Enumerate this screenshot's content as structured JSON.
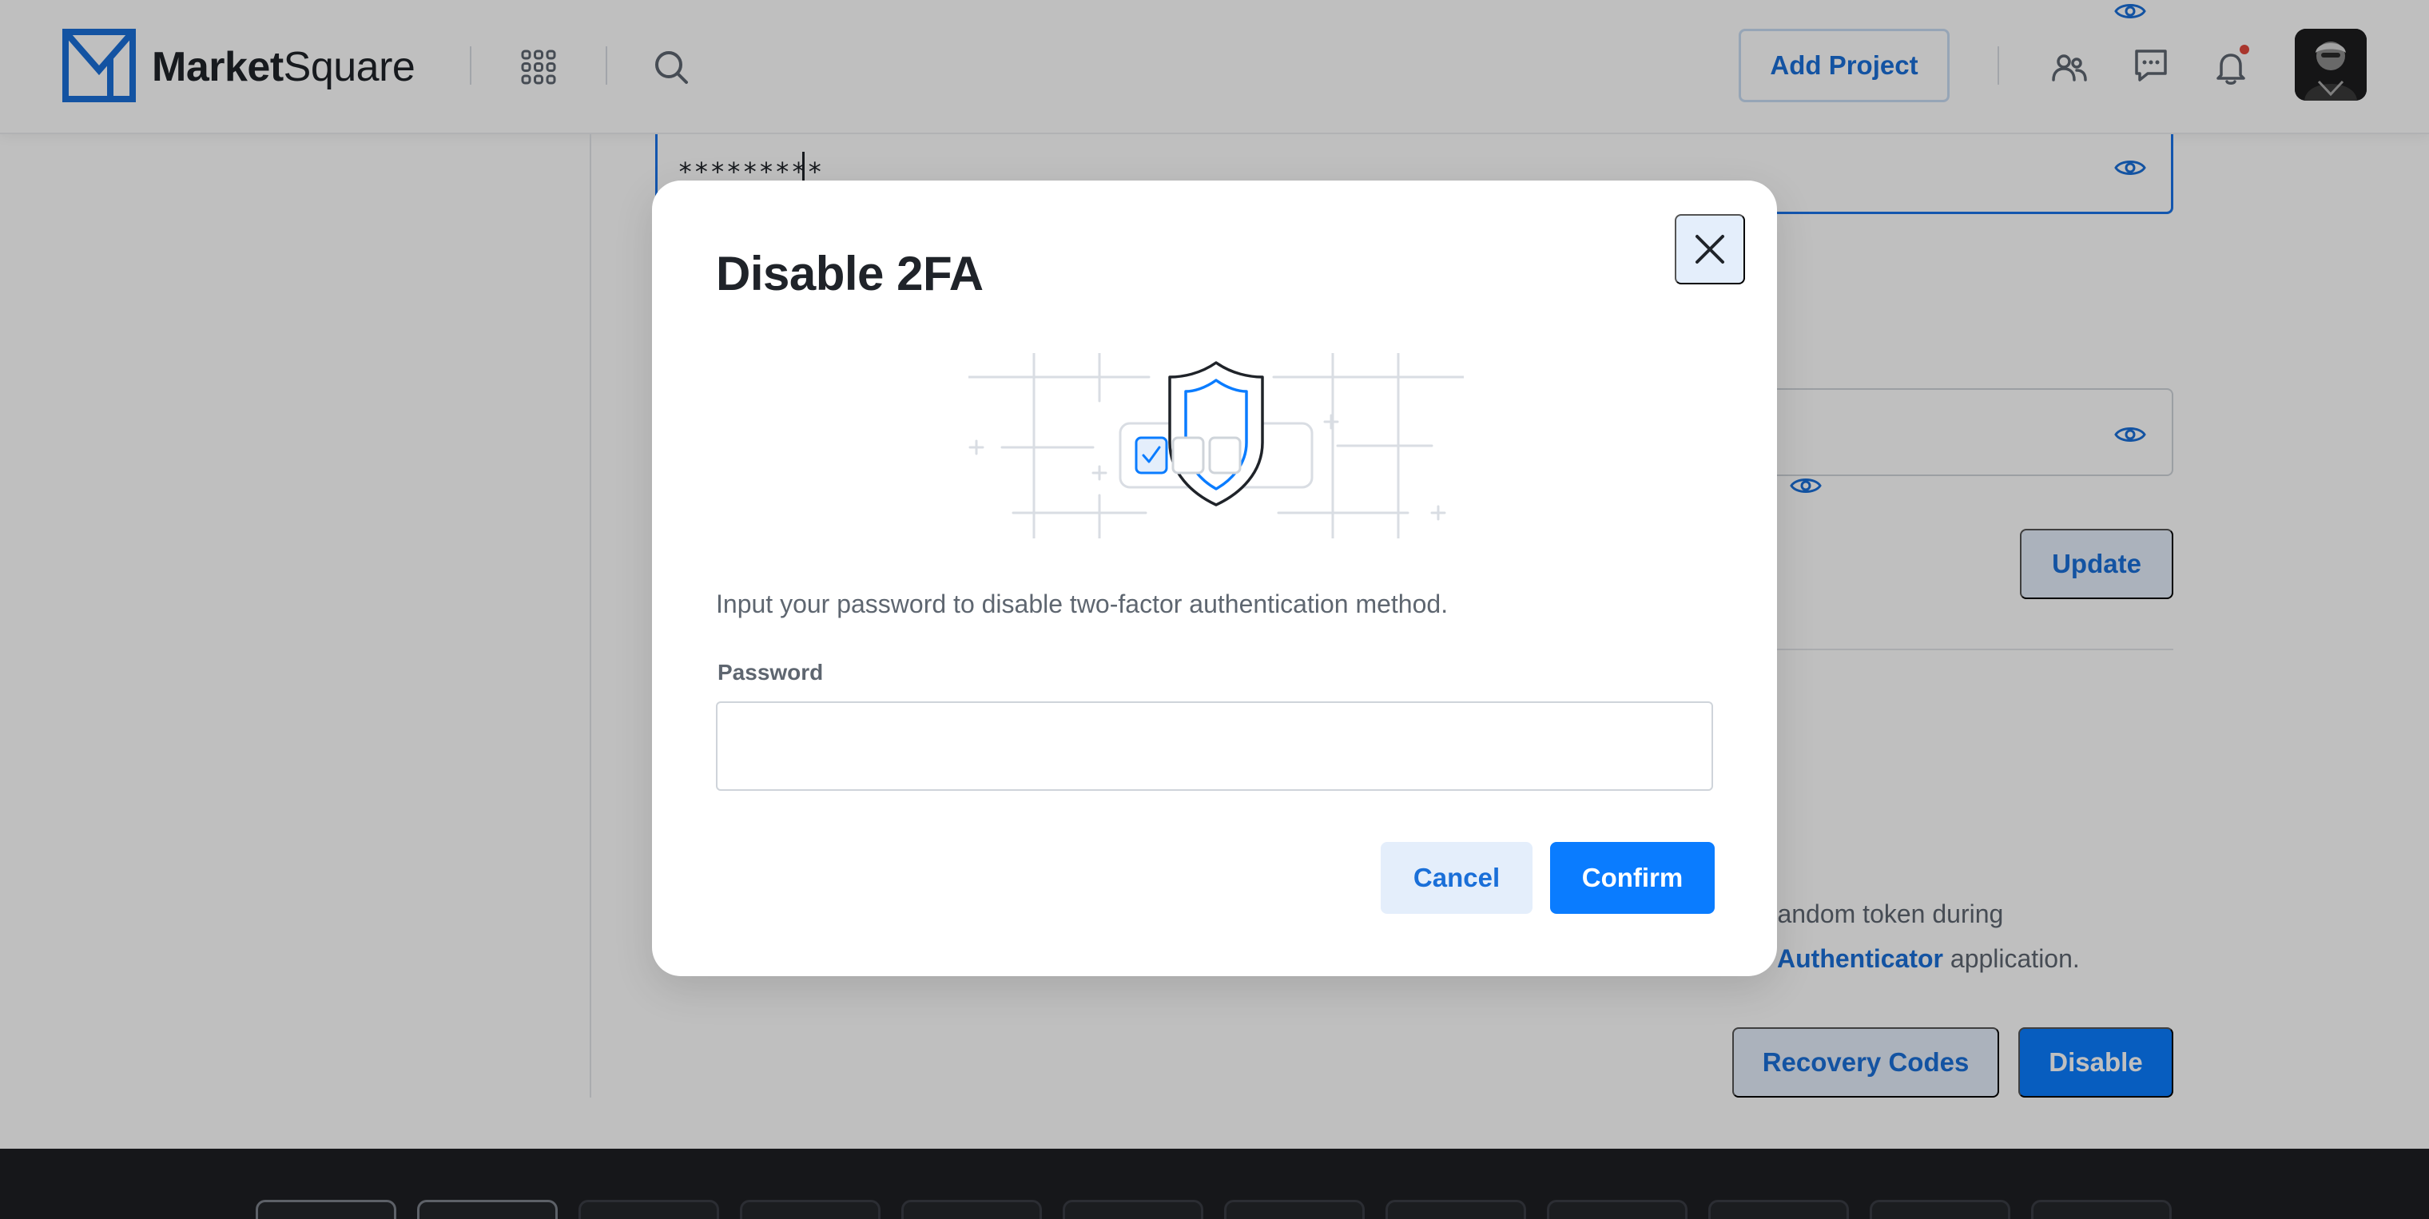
{
  "app": {
    "brand_bold": "Market",
    "brand_light": "Square"
  },
  "header": {
    "add_project_label": "Add Project",
    "icons": [
      "apps-grid-icon",
      "search-icon",
      "team-icon",
      "chat-icon",
      "bell-icon"
    ],
    "has_notification": true
  },
  "settings": {
    "masked_password": "*********",
    "update_label": "Update",
    "twofa_text_line1": ", random token during",
    "twofa_text_line2_link": "Authenticator",
    "twofa_text_line2_rest": " application.",
    "recovery_codes_label": "Recovery Codes",
    "disable_label": "Disable"
  },
  "modal": {
    "title": "Disable 2FA",
    "description": "Input your password to disable two-factor authentication method.",
    "password_label": "Password",
    "password_value": "",
    "password_placeholder": "",
    "cancel_label": "Cancel",
    "confirm_label": "Confirm"
  },
  "colors": {
    "accent": "#0a7cff",
    "link": "#1a6fd8",
    "secondary_button_bg": "#e4eefb",
    "overlay": "rgba(0,0,0,0.25)",
    "footer_bg": "#1e1f23"
  }
}
